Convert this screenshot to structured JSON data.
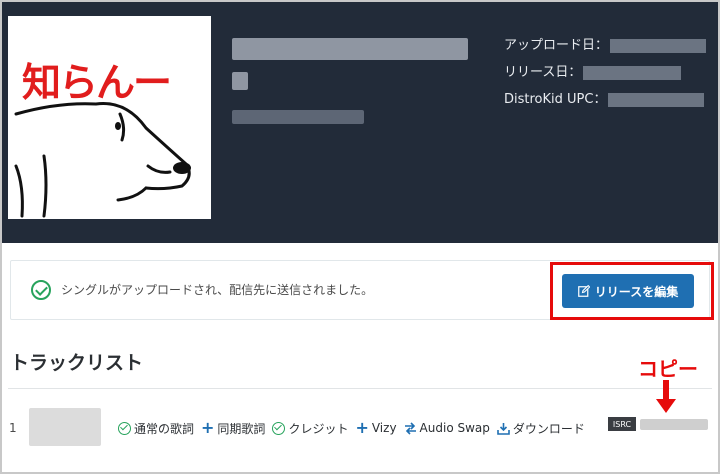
{
  "cover": {
    "text": "知らんー"
  },
  "meta": {
    "upload_label": "アップロード日：",
    "release_label": "リリース日：",
    "upc_label": "DistroKid UPC："
  },
  "notice": {
    "message": "シングルがアップロードされ、配信先に送信されました。",
    "edit_button": "リリースを編集"
  },
  "tracklist": {
    "title": "トラックリスト",
    "track_number": "1",
    "actions": [
      {
        "label": "通常の歌詞",
        "icon": "check-circle-icon"
      },
      {
        "label": "同期歌詞",
        "icon": "plus-icon"
      },
      {
        "label": "クレジット",
        "icon": "check-circle-icon"
      },
      {
        "label": "Vizy",
        "icon": "plus-icon"
      },
      {
        "label": "Audio Swap",
        "icon": "swap-icon"
      },
      {
        "label": "ダウンロード",
        "icon": "download-icon"
      }
    ],
    "isrc_tag": "ISRC"
  },
  "annotation": {
    "copy_label": "コピー"
  },
  "colors": {
    "header_bg": "#222b39",
    "accent_blue": "#1f6fb2",
    "success_green": "#27a35c",
    "annotation_red": "#e60b0b"
  }
}
